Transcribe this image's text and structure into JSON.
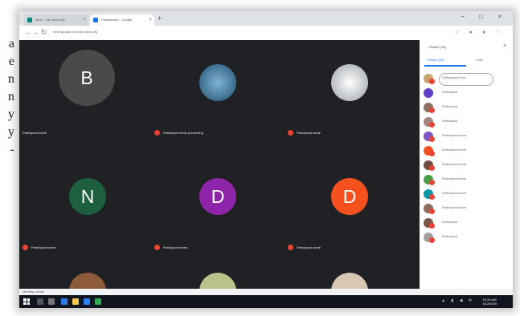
{
  "left_text": [
    "a",
    "e",
    "n",
    "n",
    "y",
    "y",
    "-"
  ],
  "browser": {
    "tabs": [
      "Meet – xyn-abcd-efg",
      "Participants – Google"
    ],
    "url": "meet.google.com/xyn-abcd-efg",
    "new_tab": "+",
    "window_controls": "– □ ×"
  },
  "tiles": [
    {
      "initial": "B",
      "color": "#5f3dc4",
      "name": "Participant name"
    },
    {
      "initial": "",
      "color": "#3b6f8f",
      "name": "Participant name presenting"
    },
    {
      "initial": "",
      "color": "#c9c9c9",
      "name": "Participant name"
    },
    {
      "initial": "N",
      "color": "#1e5f3f",
      "name": "Participant name"
    },
    {
      "initial": "D",
      "color": "#8e24aa",
      "name": "Participant name"
    },
    {
      "initial": "D",
      "color": "#f4511e",
      "name": "Participant name"
    },
    {
      "initial": "",
      "color": "#8d5a3c",
      "name": ""
    },
    {
      "initial": "",
      "color": "#b9c28a",
      "name": ""
    },
    {
      "initial": "",
      "color": "#d9c7b6",
      "name": ""
    }
  ],
  "sidebar": {
    "title": "People (16)",
    "tab_people": "People (16)",
    "tab_chat": "Chat",
    "participants": [
      {
        "color": "#c7a26b",
        "name": "Participant (You)"
      },
      {
        "color": "#5f3dc4",
        "name": "Participant"
      },
      {
        "color": "#8d6e63",
        "name": "Participant"
      },
      {
        "color": "#a1887f",
        "name": "Participant"
      },
      {
        "color": "#7e57c2",
        "name": "Participant name"
      },
      {
        "color": "#f4511e",
        "name": "Participant name"
      },
      {
        "color": "#6d4c41",
        "name": "Participant name"
      },
      {
        "color": "#43a047",
        "name": "Participant name"
      },
      {
        "color": "#0097a7",
        "name": "Participant name"
      },
      {
        "color": "#8d6e63",
        "name": "Participant name"
      },
      {
        "color": "#795548",
        "name": "Participant"
      },
      {
        "color": "#9e9e9e",
        "name": "Participant"
      }
    ]
  },
  "bottom_bar": "Meeting details",
  "taskbar": {
    "clock_time": "10:20 AM",
    "clock_date": "3/12/2020"
  }
}
